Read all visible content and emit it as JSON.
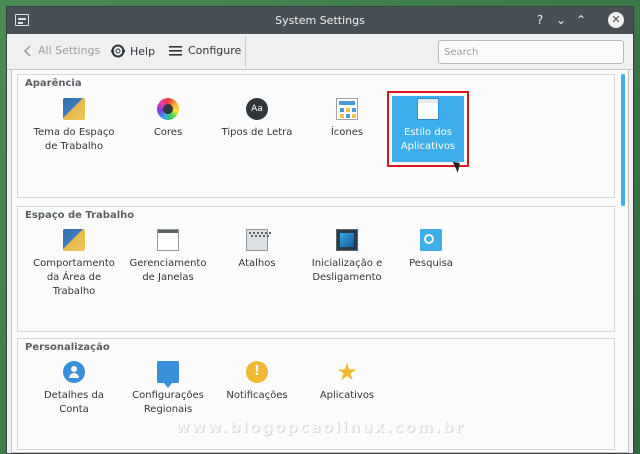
{
  "window": {
    "title": "System Settings"
  },
  "titlebar_buttons": {
    "help": "?",
    "minimize": "⌄",
    "maximize": "⌃",
    "close": "✕"
  },
  "toolbar": {
    "back_label": "All Settings",
    "help_label": "Help",
    "configure_label": "Configure",
    "search_placeholder": "Search"
  },
  "sections": [
    {
      "title": "Aparência",
      "items": [
        {
          "label": "Tema do Espaço de Trabalho",
          "icon": "workspace-theme-icon"
        },
        {
          "label": "Cores",
          "icon": "colors-icon"
        },
        {
          "label": "Tipos de Letra",
          "icon": "fonts-icon",
          "glyph": "Aa"
        },
        {
          "label": "Ícones",
          "icon": "icons-icon"
        },
        {
          "label": "Estilo dos Aplicativos",
          "icon": "application-style-icon",
          "selected": true
        }
      ]
    },
    {
      "title": "Espaço de Trabalho",
      "items": [
        {
          "label": "Comportamento da Área de Trabalho",
          "icon": "desktop-behavior-icon"
        },
        {
          "label": "Gerenciamento de Janelas",
          "icon": "window-management-icon"
        },
        {
          "label": "Atalhos",
          "icon": "shortcuts-icon"
        },
        {
          "label": "Inicialização e Desligamento",
          "icon": "startup-shutdown-icon"
        },
        {
          "label": "Pesquisa",
          "icon": "search-icon"
        }
      ]
    },
    {
      "title": "Personalização",
      "items": [
        {
          "label": "Detalhes da Conta",
          "icon": "account-details-icon"
        },
        {
          "label": "Configurações Regionais",
          "icon": "regional-settings-icon"
        },
        {
          "label": "Notificações",
          "icon": "notifications-icon",
          "glyph": "!"
        },
        {
          "label": "Aplicativos",
          "icon": "applications-icon",
          "glyph": "★"
        }
      ]
    }
  ],
  "watermark": "www.blogopcaolinux.com.br",
  "colors": {
    "accent": "#3daee9",
    "titlebar": "#475057",
    "highlight": "#da1b1b"
  }
}
